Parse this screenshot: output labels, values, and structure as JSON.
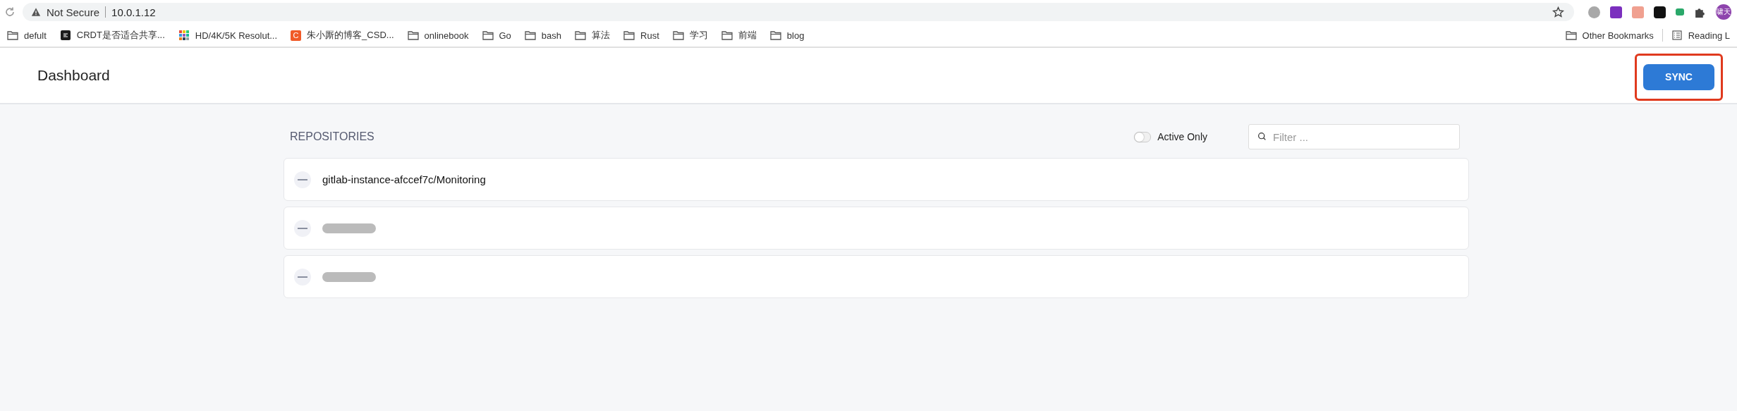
{
  "browser": {
    "security": "Not Secure",
    "url": "10.0.1.12",
    "profile": "啸天"
  },
  "bookmarks": [
    {
      "label": "defult",
      "kind": "folder"
    },
    {
      "label": "CRDT是否适合共享...",
      "kind": "app"
    },
    {
      "label": "HD/4K/5K Resolut...",
      "kind": "grid"
    },
    {
      "label": "朱小厮的博客_CSD...",
      "kind": "letter",
      "letter": "C"
    },
    {
      "label": "onlinebook",
      "kind": "folder"
    },
    {
      "label": "Go",
      "kind": "folder"
    },
    {
      "label": "bash",
      "kind": "folder"
    },
    {
      "label": "算法",
      "kind": "folder"
    },
    {
      "label": "Rust",
      "kind": "folder"
    },
    {
      "label": "学习",
      "kind": "folder"
    },
    {
      "label": "前端",
      "kind": "folder"
    },
    {
      "label": "blog",
      "kind": "folder"
    }
  ],
  "bookmarks_right": [
    {
      "label": "Other Bookmarks",
      "kind": "folder"
    },
    {
      "label": "Reading L",
      "kind": "list"
    }
  ],
  "header": {
    "title": "Dashboard",
    "sync_button": {
      "label": "SYNC",
      "highlighted": true
    }
  },
  "repositories": {
    "title": "REPOSITORIES",
    "active_only": {
      "label": "Active Only",
      "on": false
    },
    "filter": {
      "placeholder": "Filter ..."
    },
    "items": [
      {
        "kind": "name",
        "name": "gitlab-instance-afccef7c/Monitoring"
      },
      {
        "kind": "redacted"
      },
      {
        "kind": "redacted"
      }
    ]
  }
}
